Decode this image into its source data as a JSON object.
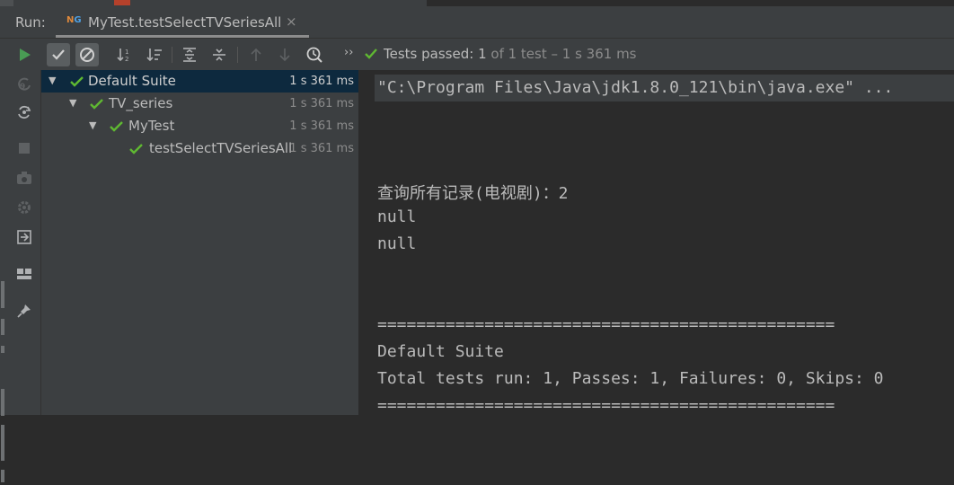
{
  "run_panel": {
    "label": "Run:",
    "tab": {
      "icon": "testng-icon",
      "title": "MyTest.testSelectTVSeriesAll",
      "close": "×"
    }
  },
  "toolbar": {
    "more_label": "››",
    "status": {
      "passed_label": "Tests passed:",
      "passed_count": "1",
      "rest": "of 1 test – 1 s 361 ms"
    }
  },
  "tree": {
    "rows": [
      {
        "name": "Default Suite",
        "time": "1 s 361 ms",
        "expanded": true
      },
      {
        "name": "TV_series",
        "time": "1 s 361 ms",
        "expanded": true
      },
      {
        "name": "MyTest",
        "time": "1 s 361 ms",
        "expanded": true
      },
      {
        "name": "testSelectTVSeriesAll",
        "time": "1 s 361 ms"
      }
    ]
  },
  "console": {
    "command": "\"C:\\Program Files\\Java\\jdk1.8.0_121\\bin\\java.exe\" ...",
    "lines": [
      "查询所有记录(电视剧)：2",
      "null",
      "null",
      "===============================================",
      "Default Suite",
      "Total tests run: 1, Passes: 1, Failures: 0, Skips: 0",
      "==============================================="
    ]
  },
  "colors": {
    "pass_green": "#5fb832",
    "run_green": "#499c54",
    "selection": "#0d293e"
  }
}
